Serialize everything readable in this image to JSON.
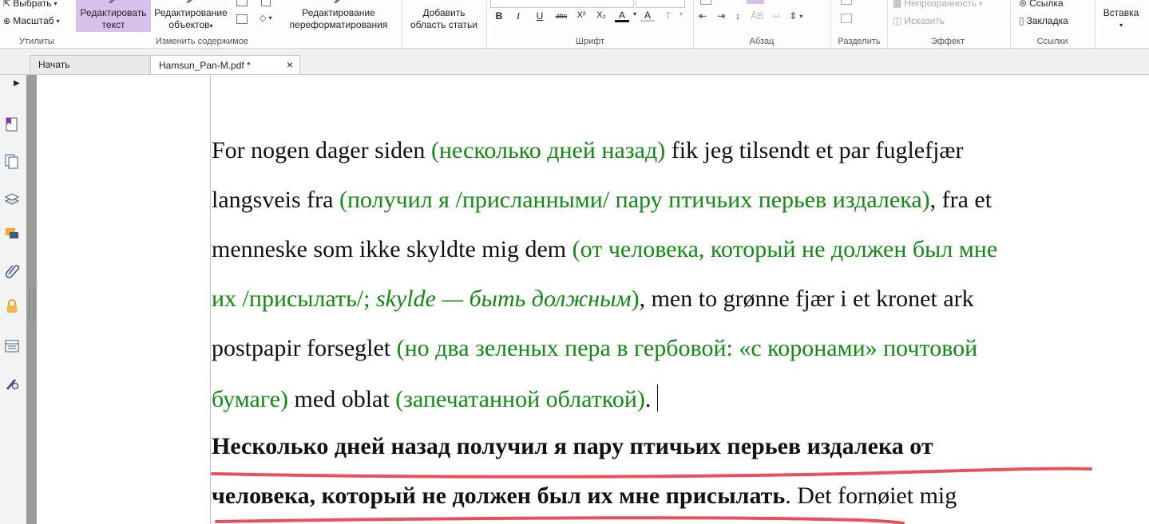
{
  "ribbon": {
    "groups": {
      "utilities": "Утилиты",
      "edit_content": "Изменить содержимое",
      "font": "Шрифт",
      "paragraph": "Абзац",
      "split": "Разделить",
      "effect": "Эффект",
      "links": "Ссылки"
    },
    "select_label": "Выбрать",
    "zoom_label": "Масштаб",
    "edit_text": [
      "Редактировать",
      "текст"
    ],
    "edit_objects": [
      "Редактирование",
      "объектов"
    ],
    "reflow": [
      "Редактирование",
      "переформатирования"
    ],
    "add_article": [
      "Добавить",
      "область статьи"
    ],
    "opacity_label": "Непрозрачность",
    "distort_label": "Исказить",
    "link_label": "Ссылка",
    "bookmark_label": "Закладка",
    "insert_label": "Вставка",
    "font_buttons": [
      "B",
      "I",
      "U",
      "abc",
      "X²",
      "X₂",
      "A",
      "A",
      "T"
    ]
  },
  "tabs": [
    {
      "label": "Начать",
      "active": false
    },
    {
      "label": "Hamsun_Pan-M.pdf *",
      "active": true,
      "close": "×"
    }
  ],
  "document": {
    "l1": {
      "a": "For nogen dager siden ",
      "b": "(несколько дней назад) ",
      "c": "fik jeg tilsendt et par fuglefjær"
    },
    "l2": {
      "a": "langsveis fra ",
      "b": "(получил я /присланными/ пару птичьих перьев издалека)",
      "c": ", fra et"
    },
    "l3": {
      "a": "menneske som ikke skyldte mig dem ",
      "b": "(от человека, который не должен был мне"
    },
    "l4": {
      "a": "их /присылать/; ",
      "b": "skylde — быть должным",
      "c": ")",
      "d": ", men to grønne fjær i et kronet ark"
    },
    "l5": {
      "a": "postpapir forseglet ",
      "b": "(но два зеленых пера в гербовой: «с коронами» почтовой"
    },
    "l6": {
      "a": "бумаге) ",
      "b": "med oblat ",
      "c": "(запечатанной облаткой)",
      "d": "."
    },
    "l7": {
      "a": "Несколько дней назад получил я пару птичьих перьев издалека от"
    },
    "l8": {
      "a": "человека, который не должен был их мне присылать",
      "b": ".  Det fornøiet mig"
    }
  },
  "colors": {
    "russian_text": "#118a11",
    "highlight_button": "#d7c1ea",
    "annotation": "#e8505b"
  }
}
